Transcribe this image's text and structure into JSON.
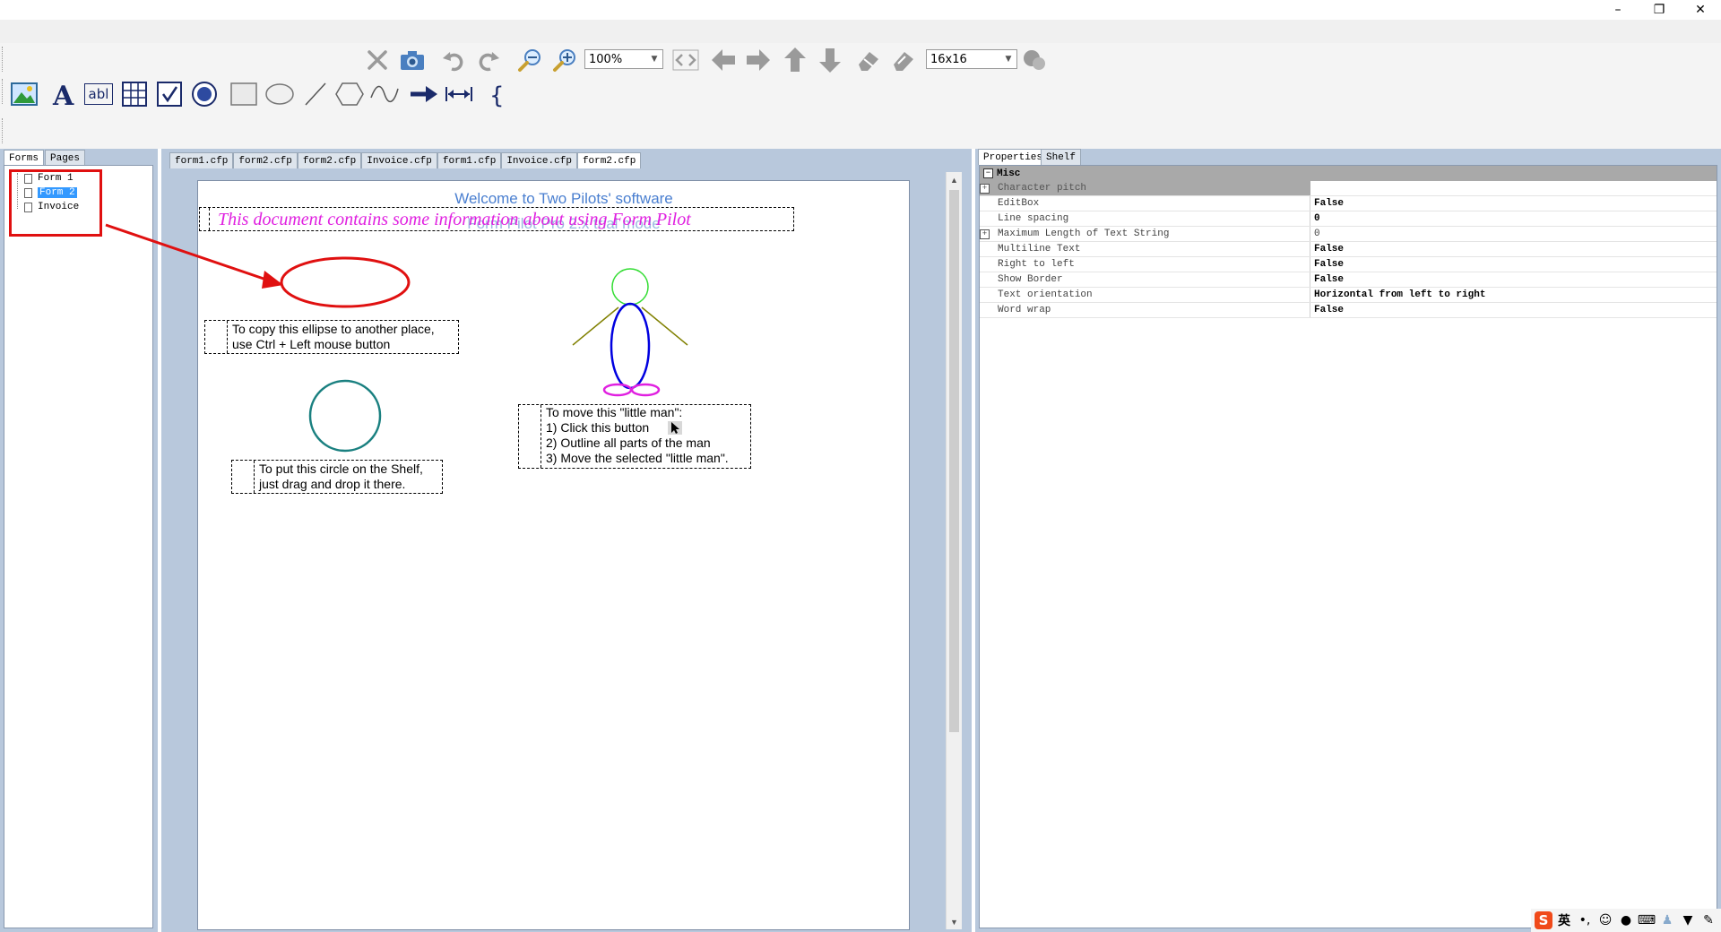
{
  "window": {
    "min": "–",
    "restore": "❐",
    "close": "✕"
  },
  "toolbar": {
    "zoom_value": "100%",
    "icon_size_value": "16x16",
    "row1_icons": [
      "cut-icon",
      "camera-icon",
      "undo-icon",
      "redo-icon",
      "zoom-out-icon",
      "zoom-in-icon"
    ],
    "row1_right_icons": [
      "nav-prev-next-icon",
      "arrow-left-icon",
      "arrow-right-icon",
      "arrow-up-icon",
      "arrow-down-icon",
      "eraser-icon",
      "eraser-alt-icon"
    ],
    "row2_icons": [
      "image-tool-icon",
      "text-tool-icon",
      "editbox-tool-icon",
      "table-tool-icon",
      "checkbox-tool-icon",
      "radio-tool-icon",
      "rectangle-tool-icon",
      "ellipse-tool-icon",
      "line-tool-icon",
      "polygon-tool-icon",
      "curve-tool-icon",
      "arrow-tool-icon",
      "dimension-tool-icon",
      "brace-tool-icon"
    ],
    "editbox_label": "abl"
  },
  "left_panel": {
    "tabs": [
      "Forms",
      "Pages"
    ],
    "tree": [
      "Form 1",
      "Form 2",
      "Invoice"
    ],
    "selected_index": 1
  },
  "doc_tabs": [
    "form1.cfp",
    "form2.cfp",
    "form2.cfp",
    "Invoice.cfp",
    "form1.cfp",
    "Invoice.cfp",
    "form2.cfp"
  ],
  "canvas": {
    "heading1": "Welcome to Two Pilots' software",
    "heading2": "Form Pilot Pro 2.x trial mode",
    "magenta_line": "This document contains some information about using Form Pilot",
    "ellipse_text_1": "To copy this ellipse to another place,",
    "ellipse_text_2": "use Ctrl + Left mouse button",
    "circle_text_1": "To put this circle on the Shelf,",
    "circle_text_2": "just drag and drop it there.",
    "man_text_1": "To move this \"little man\":",
    "man_text_2": "1) Click this button",
    "man_text_3": "2) Outline all parts of the man",
    "man_text_4": "3) Move the selected \"little man\"."
  },
  "right_panel": {
    "tabs": [
      "Properties",
      "Shelf"
    ],
    "category": "Misc",
    "properties": [
      {
        "name": "Character pitch",
        "value": ""
      },
      {
        "name": "EditBox",
        "value": "False"
      },
      {
        "name": "Line spacing",
        "value": "0"
      },
      {
        "name": "Maximum Length of Text String",
        "value": "0"
      },
      {
        "name": "Multiline Text",
        "value": "False"
      },
      {
        "name": "Right to left",
        "value": "False"
      },
      {
        "name": "Show Border",
        "value": "False"
      },
      {
        "name": "Text orientation",
        "value": "Horizontal from left to right"
      },
      {
        "name": "Word wrap",
        "value": "False"
      }
    ]
  },
  "tray": {
    "ime": "英"
  },
  "colors": {
    "accent": "#3399ff",
    "annotation_red": "#e01010",
    "magenta": "#e020e0",
    "teal": "#1a8080",
    "blue_body": "#0000e0",
    "green_head": "#33dd33",
    "olive_arms": "#808000"
  }
}
